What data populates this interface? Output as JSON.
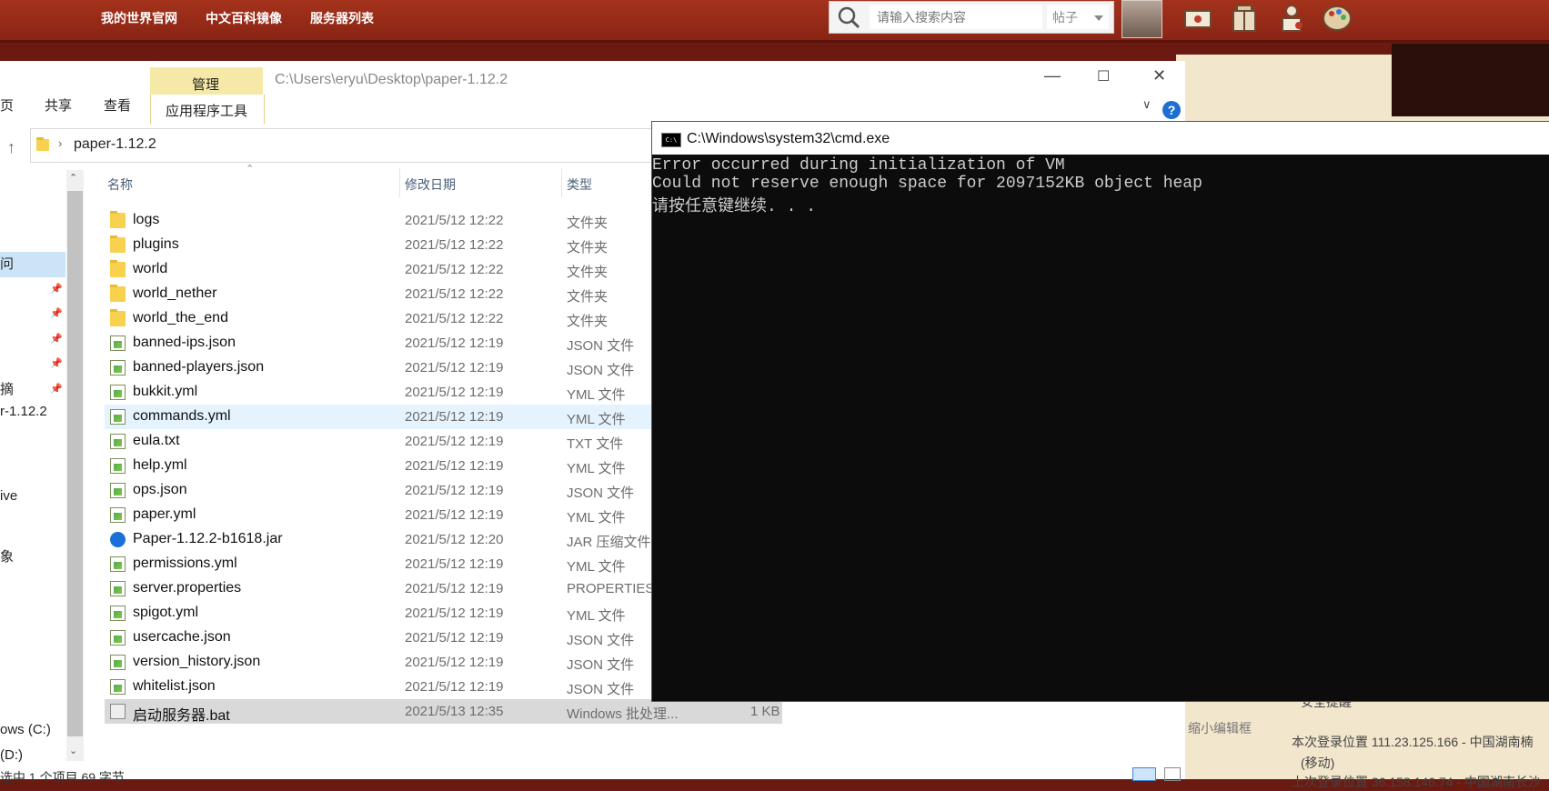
{
  "forum_bar": {
    "links": [
      "我的世界官网",
      "中文百科镜像",
      "服务器列表"
    ],
    "search_placeholder": "请输入搜索内容",
    "search_scope": "帖子"
  },
  "explorer": {
    "ribbon": {
      "tab_home": "页",
      "tab_share": "共享",
      "tab_view": "查看",
      "tab_manage": "管理",
      "tab_apptools": "应用程序工具"
    },
    "title_path": "C:\\Users\\eryu\\Desktop\\paper-1.12.2",
    "address_folder": "paper-1.12.2",
    "columns": {
      "name": "名称",
      "date": "修改日期",
      "type": "类型"
    },
    "nav": {
      "items": [
        "问",
        "摘",
        "r-1.12.2",
        "ive",
        "象",
        "ows (C:)",
        "(D:)"
      ]
    },
    "files": [
      {
        "name": "logs",
        "date": "2021/5/12 12:22",
        "type": "文件夹",
        "size": "",
        "kind": "folder"
      },
      {
        "name": "plugins",
        "date": "2021/5/12 12:22",
        "type": "文件夹",
        "size": "",
        "kind": "folder"
      },
      {
        "name": "world",
        "date": "2021/5/12 12:22",
        "type": "文件夹",
        "size": "",
        "kind": "folder"
      },
      {
        "name": "world_nether",
        "date": "2021/5/12 12:22",
        "type": "文件夹",
        "size": "",
        "kind": "folder"
      },
      {
        "name": "world_the_end",
        "date": "2021/5/12 12:22",
        "type": "文件夹",
        "size": "",
        "kind": "folder"
      },
      {
        "name": "banned-ips.json",
        "date": "2021/5/12 12:19",
        "type": "JSON 文件",
        "size": "",
        "kind": "file"
      },
      {
        "name": "banned-players.json",
        "date": "2021/5/12 12:19",
        "type": "JSON 文件",
        "size": "",
        "kind": "file"
      },
      {
        "name": "bukkit.yml",
        "date": "2021/5/12 12:19",
        "type": "YML 文件",
        "size": "",
        "kind": "file"
      },
      {
        "name": "commands.yml",
        "date": "2021/5/12 12:19",
        "type": "YML 文件",
        "size": "",
        "kind": "file"
      },
      {
        "name": "eula.txt",
        "date": "2021/5/12 12:19",
        "type": "TXT 文件",
        "size": "",
        "kind": "file"
      },
      {
        "name": "help.yml",
        "date": "2021/5/12 12:19",
        "type": "YML 文件",
        "size": "",
        "kind": "file"
      },
      {
        "name": "ops.json",
        "date": "2021/5/12 12:19",
        "type": "JSON 文件",
        "size": "",
        "kind": "file"
      },
      {
        "name": "paper.yml",
        "date": "2021/5/12 12:19",
        "type": "YML 文件",
        "size": "",
        "kind": "file"
      },
      {
        "name": "Paper-1.12.2-b1618.jar",
        "date": "2021/5/12 12:20",
        "type": "JAR 压缩文件",
        "size": "",
        "kind": "jar"
      },
      {
        "name": "permissions.yml",
        "date": "2021/5/12 12:19",
        "type": "YML 文件",
        "size": "",
        "kind": "file"
      },
      {
        "name": "server.properties",
        "date": "2021/5/12 12:19",
        "type": "PROPERTIES",
        "size": "",
        "kind": "file"
      },
      {
        "name": "spigot.yml",
        "date": "2021/5/12 12:19",
        "type": "YML 文件",
        "size": "",
        "kind": "file"
      },
      {
        "name": "usercache.json",
        "date": "2021/5/12 12:19",
        "type": "JSON 文件",
        "size": "",
        "kind": "file"
      },
      {
        "name": "version_history.json",
        "date": "2021/5/12 12:19",
        "type": "JSON 文件",
        "size": "",
        "kind": "file"
      },
      {
        "name": "whitelist.json",
        "date": "2021/5/12 12:19",
        "type": "JSON 文件",
        "size": "",
        "kind": "file"
      },
      {
        "name": "启动服务器.bat",
        "date": "2021/5/13 12:35",
        "type": "Windows 批处理...",
        "size": "1 KB",
        "kind": "bat"
      }
    ],
    "status": "选中 1 个项目  69 字节"
  },
  "cmd": {
    "title": "C:\\Windows\\system32\\cmd.exe",
    "icon_text": "C:\\",
    "lines": [
      "Error occurred during initialization of VM",
      "Could not reserve enough space for 2097152KB object heap",
      "请按任意键继续. . ."
    ]
  },
  "forum_side": {
    "shrink_editor": "缩小编辑框",
    "login_location": "本次登录位置 111.23.125.166 - 中国湖南楠",
    "login_carrier": "(移动)",
    "prev_login": "上次登录位置 36.158.146.74 - 中国湖南长沙",
    "tip": "安全提醒"
  }
}
